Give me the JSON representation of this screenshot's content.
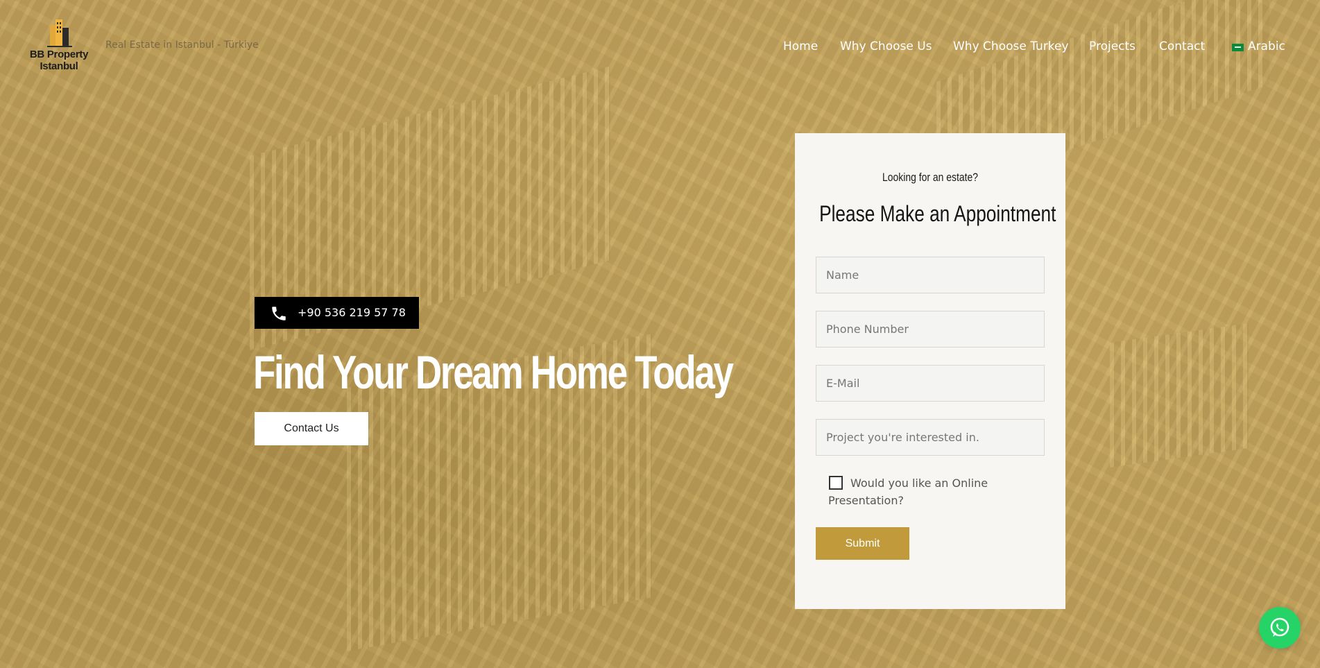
{
  "header": {
    "logo_line1": "BB Property",
    "logo_line2": "Istanbul",
    "tagline": "Real Estate in Istanbul - Türkiye",
    "nav": [
      {
        "label": "Home"
      },
      {
        "label": "Why Choose Us"
      },
      {
        "label": "Why Choose Turkey"
      },
      {
        "label": "Projects"
      },
      {
        "label": "Contact"
      },
      {
        "label": "Arabic"
      }
    ]
  },
  "hero": {
    "phone": "+90 536 219 57 78",
    "title": "Find Your Dream Home Today",
    "cta_label": "Contact Us"
  },
  "form": {
    "eyebrow": "Looking for an estate?",
    "title": "Please Make an Appointment",
    "fields": {
      "name_placeholder": "Name",
      "phone_placeholder": "Phone Number",
      "email_placeholder": "E-Mail",
      "project_placeholder": "Project you're interested in."
    },
    "checkbox_label": "Would you like an Online Presentation?",
    "submit_label": "Submit"
  },
  "colors": {
    "accent": "#c19a3b",
    "whatsapp": "#25d366"
  },
  "icons": {
    "phone": "phone-icon",
    "whatsapp": "whatsapp-icon",
    "flag": "saudi-flag-icon"
  }
}
